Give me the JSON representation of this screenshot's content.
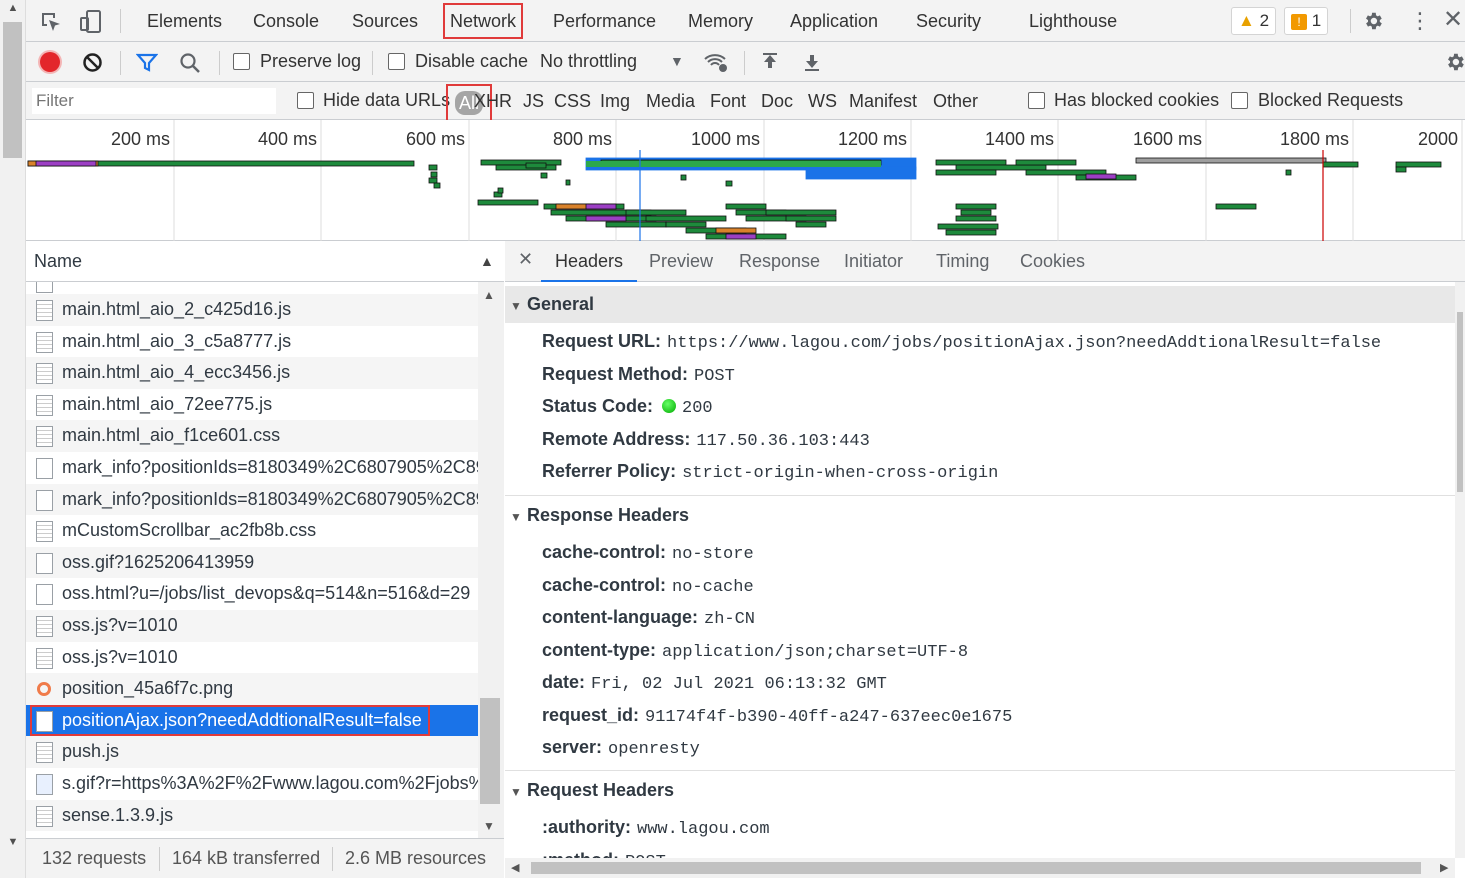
{
  "top_tabs": [
    "Elements",
    "Console",
    "Sources",
    "Network",
    "Performance",
    "Memory",
    "Application",
    "Security",
    "Lighthouse"
  ],
  "active_tab": "Network",
  "warnings_count": "2",
  "issues_count": "1",
  "toolbar": {
    "preserve_log": "Preserve log",
    "disable_cache": "Disable cache",
    "throttling": "No throttling"
  },
  "filter": {
    "placeholder": "Filter",
    "hide_data_urls": "Hide data URLs",
    "types": [
      "All",
      "XHR",
      "JS",
      "CSS",
      "Img",
      "Media",
      "Font",
      "Doc",
      "WS",
      "Manifest",
      "Other"
    ],
    "has_blocked_cookies": "Has blocked cookies",
    "blocked_requests": "Blocked Requests"
  },
  "timeline_ticks": [
    "200 ms",
    "400 ms",
    "600 ms",
    "800 ms",
    "1000 ms",
    "1200 ms",
    "1400 ms",
    "1600 ms",
    "1800 ms",
    "2000"
  ],
  "name_header": "Name",
  "requests": [
    {
      "name": "main.html_aio_2_c425d16.js",
      "icon": "file"
    },
    {
      "name": "main.html_aio_3_c5a8777.js",
      "icon": "file"
    },
    {
      "name": "main.html_aio_4_ecc3456.js",
      "icon": "file"
    },
    {
      "name": "main.html_aio_72ee775.js",
      "icon": "file"
    },
    {
      "name": "main.html_aio_f1ce601.css",
      "icon": "file"
    },
    {
      "name": "mark_info?positionIds=8180349%2C6807905%2C89...",
      "icon": "blank"
    },
    {
      "name": "mark_info?positionIds=8180349%2C6807905%2C89...",
      "icon": "blank"
    },
    {
      "name": "mCustomScrollbar_ac2fb8b.css",
      "icon": "file"
    },
    {
      "name": "oss.gif?1625206413959",
      "icon": "blank"
    },
    {
      "name": "oss.html?u=/jobs/list_devops&q=514&n=516&d=29",
      "icon": "blank"
    },
    {
      "name": "oss.js?v=1010",
      "icon": "file"
    },
    {
      "name": "oss.js?v=1010",
      "icon": "file"
    },
    {
      "name": "position_45a6f7c.png",
      "icon": "image"
    },
    {
      "name": "positionAjax.json?needAddtionalResult=false",
      "icon": "blank"
    },
    {
      "name": "push.js",
      "icon": "file"
    },
    {
      "name": "s.gif?r=https%3A%2F%2Fwww.lagou.com%2Fjobs%2...",
      "icon": "img"
    },
    {
      "name": "sense.1.3.9.js",
      "icon": "file"
    }
  ],
  "selected_index": 13,
  "status": {
    "requests": "132 requests",
    "transferred": "164 kB transferred",
    "resources": "2.6 MB resources"
  },
  "detail_tabs": [
    "Headers",
    "Preview",
    "Response",
    "Initiator",
    "Timing",
    "Cookies"
  ],
  "active_detail_tab": "Headers",
  "general": {
    "title": "General",
    "items": [
      {
        "k": "Request URL:",
        "v": "https://www.lagou.com/jobs/positionAjax.json?needAddtionalResult=false"
      },
      {
        "k": "Request Method:",
        "v": "POST"
      },
      {
        "k": "Status Code:",
        "v": "200"
      },
      {
        "k": "Remote Address:",
        "v": "117.50.36.103:443"
      },
      {
        "k": "Referrer Policy:",
        "v": "strict-origin-when-cross-origin"
      }
    ]
  },
  "response_headers": {
    "title": "Response Headers",
    "items": [
      {
        "k": "cache-control:",
        "v": "no-store"
      },
      {
        "k": "cache-control:",
        "v": "no-cache"
      },
      {
        "k": "content-language:",
        "v": "zh-CN"
      },
      {
        "k": "content-type:",
        "v": "application/json;charset=UTF-8"
      },
      {
        "k": "date:",
        "v": "Fri, 02 Jul 2021 06:13:32 GMT"
      },
      {
        "k": "request_id:",
        "v": "91174f4f-b390-40ff-a247-637eec0e1675"
      },
      {
        "k": "server:",
        "v": "openresty"
      }
    ]
  },
  "request_headers": {
    "title": "Request Headers",
    "items": [
      {
        "k": ":authority:",
        "v": "www.lagou.com"
      },
      {
        "k": ":method:",
        "v": "POST"
      }
    ]
  },
  "colors": {
    "accent": "#1a73e8",
    "highlight": "#e03a3a",
    "status_ok": "#0a0",
    "bar_green": "#1e8a3c",
    "bar_purple": "#9c3fc4",
    "bar_orange": "#d9822b"
  }
}
